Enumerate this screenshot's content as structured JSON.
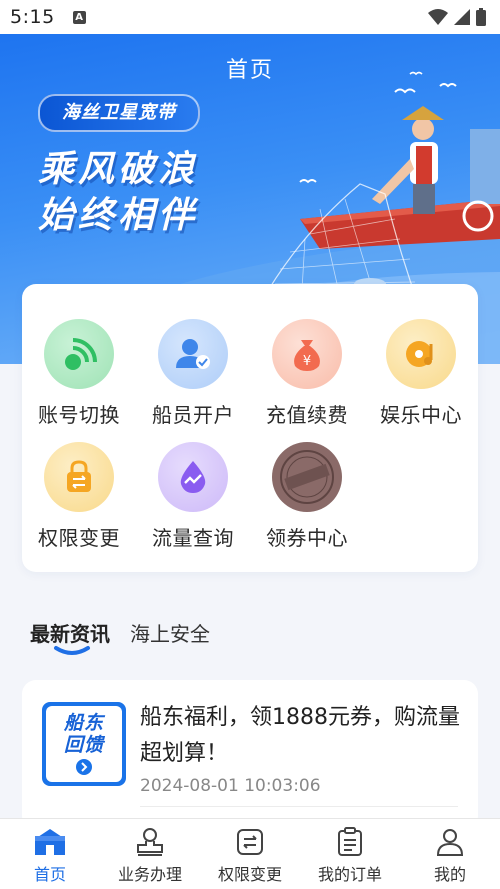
{
  "status_bar": {
    "time": "5:15"
  },
  "header": {
    "title": "首页"
  },
  "banner": {
    "badge": "海丝卫星宽带",
    "slogan_line1": "乘风破浪",
    "slogan_line2": "始终相伴"
  },
  "services": [
    {
      "label": "账号切换",
      "icon": "signal-icon",
      "color": "#3fc46d"
    },
    {
      "label": "船员开户",
      "icon": "user-check-icon",
      "color": "#3e86ea"
    },
    {
      "label": "充值续费",
      "icon": "money-bag-icon",
      "color": "#f26b4f"
    },
    {
      "label": "娱乐中心",
      "icon": "music-disc-icon",
      "color": "#f5a623"
    },
    {
      "label": "权限变更",
      "icon": "lock-switch-icon",
      "color": "#f5a623"
    },
    {
      "label": "流量查询",
      "icon": "data-drop-icon",
      "color": "#8a5cf0"
    },
    {
      "label": "领券中心",
      "icon": "coupon-stamp-icon",
      "color": "#8a6a68",
      "stamp_text": "敬请期待"
    }
  ],
  "news_tabs": [
    {
      "label": "最新资讯",
      "active": true
    },
    {
      "label": "海上安全",
      "active": false
    }
  ],
  "news": [
    {
      "thumb_line1": "船东",
      "thumb_line2": "回馈",
      "title": "船东福利，领1888元券，购流量超划算！",
      "time": "2024-08-01 10:03:06"
    }
  ],
  "bottom_nav": [
    {
      "label": "首页",
      "icon": "home-icon",
      "active": true
    },
    {
      "label": "业务办理",
      "icon": "stamp-icon",
      "active": false
    },
    {
      "label": "权限变更",
      "icon": "switch-doc-icon",
      "active": false
    },
    {
      "label": "我的订单",
      "icon": "order-list-icon",
      "active": false
    },
    {
      "label": "我的",
      "icon": "profile-icon",
      "active": false
    }
  ],
  "colors": {
    "primary": "#1f6fe5",
    "background": "#f3f5fa"
  }
}
